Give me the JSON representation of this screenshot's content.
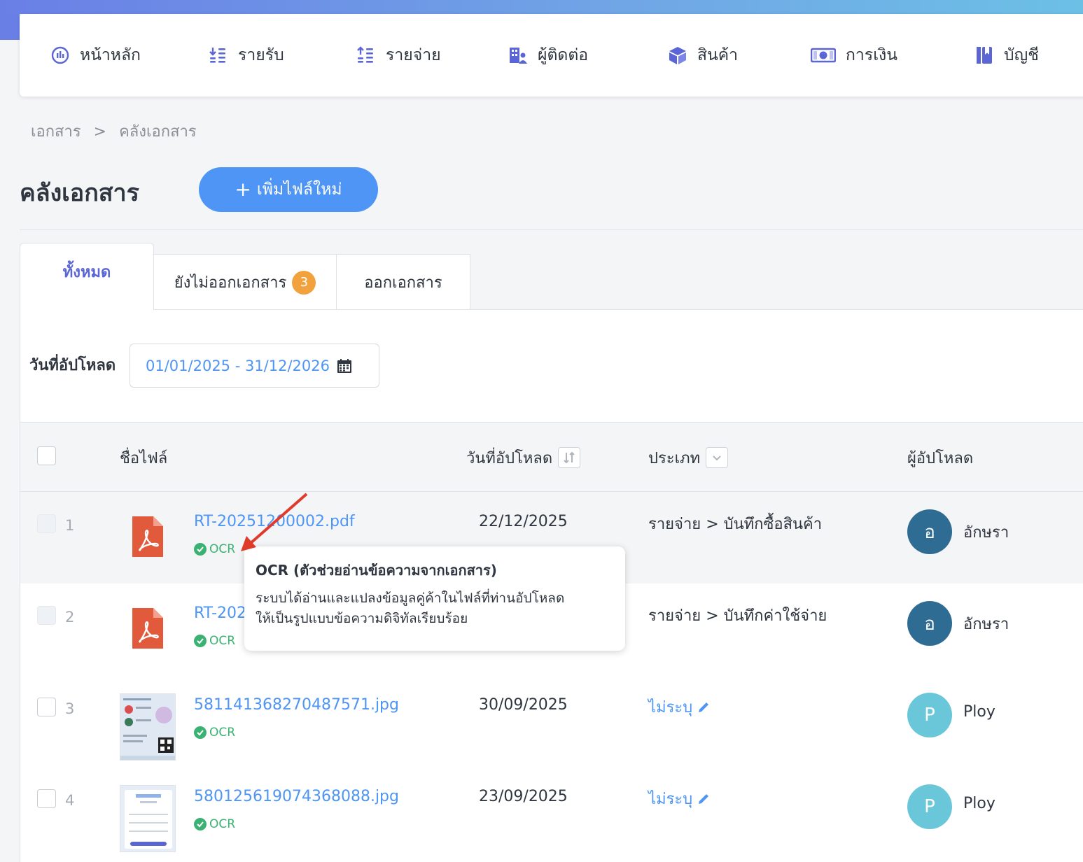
{
  "nav": {
    "items": [
      {
        "label": "หน้าหลัก",
        "icon": "dashboard-icon"
      },
      {
        "label": "รายรับ",
        "icon": "income-icon"
      },
      {
        "label": "รายจ่าย",
        "icon": "expense-icon"
      },
      {
        "label": "ผู้ติดต่อ",
        "icon": "contacts-icon"
      },
      {
        "label": "สินค้า",
        "icon": "box-icon"
      },
      {
        "label": "การเงิน",
        "icon": "money-icon"
      },
      {
        "label": "บัญชี",
        "icon": "ledger-icon"
      }
    ]
  },
  "breadcrumb": {
    "root": "เอกสาร",
    "sep": ">",
    "current": "คลังเอกสาร"
  },
  "page": {
    "title": "คลังเอกสาร",
    "add_button": "เพิ่มไฟล์ใหม่",
    "add_plus": "+"
  },
  "tabs": [
    {
      "label": "ทั้งหมด",
      "active": true
    },
    {
      "label": "ยังไม่ออกเอกสาร",
      "badge": "3"
    },
    {
      "label": "ออกเอกสาร"
    }
  ],
  "filter": {
    "label": "วันที่อัปโหลด",
    "date_range": "01/01/2025 - 31/12/2026"
  },
  "table": {
    "headers": {
      "filename": "ชื่อไฟล์",
      "upload_date": "วันที่อัปโหลด",
      "type": "ประเภท",
      "uploader": "ผู้อัปโหลด"
    },
    "rows": [
      {
        "num": "1",
        "file": "RT-20251200002.pdf",
        "ocr": "OCR",
        "date": "22/12/2025",
        "type": "รายจ่าย > บันทึกซื้อสินค้า",
        "avatar": "อ",
        "avatar_color": "#2e6c94",
        "user": "อักษรา"
      },
      {
        "num": "2",
        "file": "RT-20251200001.pdf",
        "file_visible": "RT-202",
        "ocr": "OCR",
        "date": "",
        "type": "รายจ่าย > บันทึกค่าใช้จ่าย",
        "avatar": "อ",
        "avatar_color": "#2e6c94",
        "user": "อักษรา"
      },
      {
        "num": "3",
        "file": "581141368270487571.jpg",
        "ocr": "OCR",
        "date": "30/09/2025",
        "type": "ไม่ระบุ",
        "avatar": "P",
        "avatar_color": "#6ac7d9",
        "user": "Ploy"
      },
      {
        "num": "4",
        "file": "580125619074368088.jpg",
        "ocr": "OCR",
        "date": "23/09/2025",
        "type": "ไม่ระบุ",
        "avatar": "P",
        "avatar_color": "#6ac7d9",
        "user": "Ploy"
      }
    ]
  },
  "tooltip": {
    "title": "OCR (ตัวช่วยอ่านข้อความจากเอกสาร)",
    "line1": "ระบบได้อ่านและแปลงข้อมูลคู่ค้าในไฟล์ที่ท่านอัปโหลด",
    "line2": "ให้เป็นรูปแบบข้อความดิจิทัลเรียบร้อย"
  },
  "colors": {
    "primary": "#4e95f5",
    "accent": "#5a66d6",
    "ocr_green": "#3bb273",
    "pdf_red": "#e25a3c",
    "badge": "#f2a23c"
  }
}
